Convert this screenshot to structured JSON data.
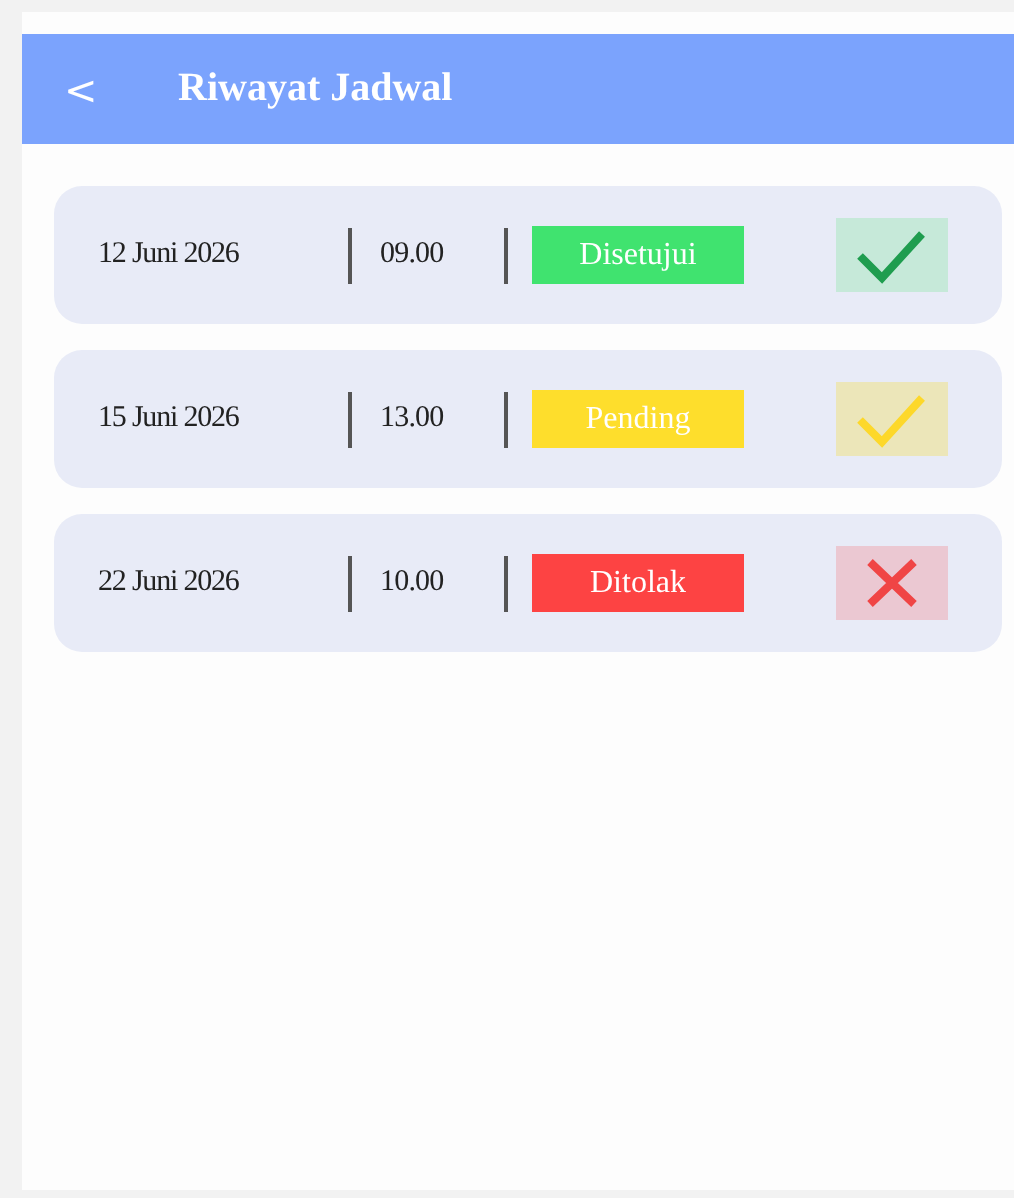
{
  "header": {
    "back": "<",
    "title": "Riwayat Jadwal"
  },
  "entries": [
    {
      "date": "12 Juni 2026",
      "time": "09.00",
      "status": "Disetujui",
      "kind": "approved",
      "color": "#40e36f"
    },
    {
      "date": "15 Juni 2026",
      "time": "13.00",
      "status": "Pending",
      "kind": "pending",
      "color": "#fede2c"
    },
    {
      "date": "22 Juni 2026",
      "time": "10.00",
      "status": "Ditolak",
      "kind": "rejected",
      "color": "#fd4343"
    }
  ]
}
